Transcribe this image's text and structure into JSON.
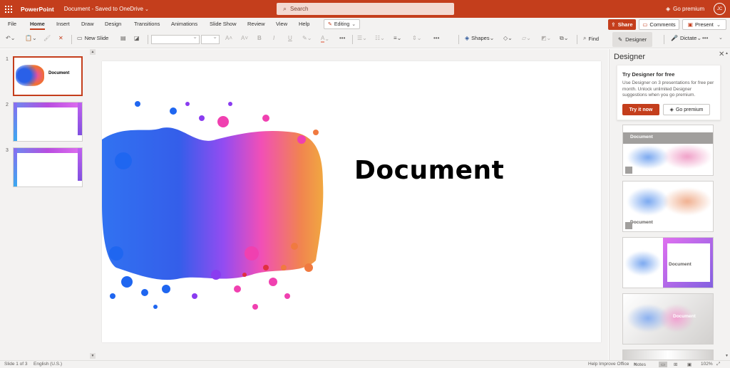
{
  "titlebar": {
    "app_name": "PowerPoint",
    "doc_name": "Document",
    "save_status": "Saved to OneDrive",
    "search_placeholder": "Search",
    "go_premium": "Go premium",
    "avatar_initials": "JC"
  },
  "tabs": [
    "File",
    "Home",
    "Insert",
    "Draw",
    "Design",
    "Transitions",
    "Animations",
    "Slide Show",
    "Review",
    "View",
    "Help"
  ],
  "active_tab": "Home",
  "mode_button": "Editing",
  "actions": {
    "share": "Share",
    "comments": "Comments",
    "present": "Present"
  },
  "ribbon": {
    "new_slide": "New Slide",
    "shapes": "Shapes",
    "find": "Find",
    "designer": "Designer",
    "dictate": "Dictate"
  },
  "thumbnails": [
    {
      "number": "1",
      "title": "Document"
    },
    {
      "number": "2"
    },
    {
      "number": "3"
    }
  ],
  "slide": {
    "title": "Document"
  },
  "designer_pane": {
    "title": "Designer",
    "promo_title": "Try Designer for free",
    "promo_text": "Use Designer on 3 presentations for free per month. Unlock unlimited Designer suggestions when you go premium.",
    "try_button": "Try it now",
    "premium_button": "Go premium",
    "card_label": "Document"
  },
  "statusbar": {
    "slide_info": "Slide 1 of 3",
    "language": "English (U.S.)",
    "help_improve": "Help Improve Office",
    "notes": "Notes",
    "zoom": "102%"
  },
  "colors": {
    "accent": "#c43e1c",
    "chrome": "#f3f2f1"
  }
}
